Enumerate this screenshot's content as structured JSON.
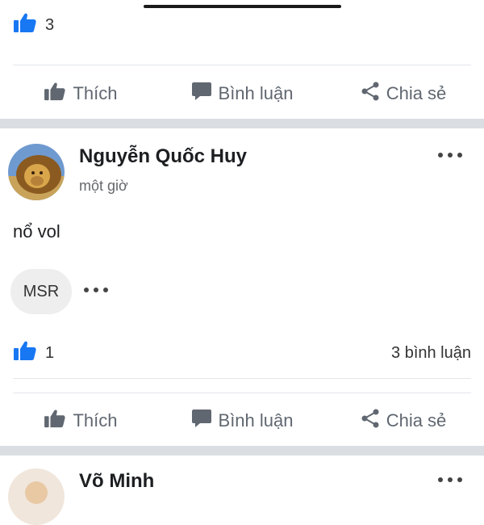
{
  "colors": {
    "accent": "#1877f2",
    "separator": "#dadde1",
    "muted": "#606770"
  },
  "icons": {
    "like": "thumbs-up-icon",
    "comment": "speech-bubble-icon",
    "share": "share-icon",
    "menu": "more-dots-icon"
  },
  "prev_post": {
    "like_count": "3",
    "actions": {
      "like": "Thích",
      "comment": "Bình luận",
      "share": "Chia sẻ"
    }
  },
  "post": {
    "author": "Nguyễn Quốc Huy",
    "time": "một giờ",
    "text": "nổ vol",
    "tag": "MSR",
    "like_count": "1",
    "comment_count": "3 bình luận",
    "actions": {
      "like": "Thích",
      "comment": "Bình luận",
      "share": "Chia sẻ"
    }
  },
  "next_post": {
    "author": "Võ Minh"
  }
}
